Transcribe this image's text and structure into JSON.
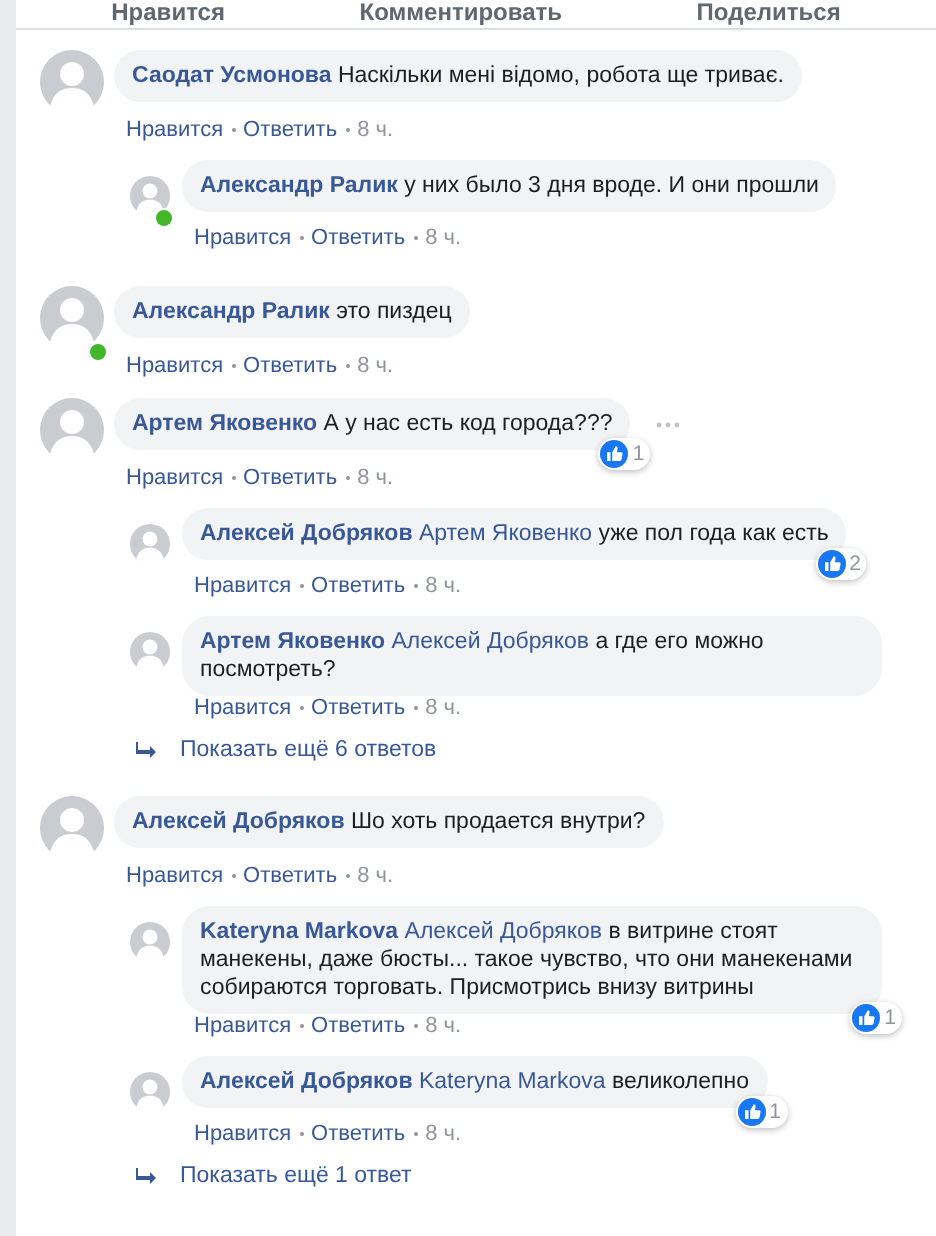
{
  "actions": [
    {
      "label": "Нравится"
    },
    {
      "label": "Комментировать"
    },
    {
      "label": "Поделиться"
    }
  ],
  "comments": [
    {
      "author": "Саодат Усмонова",
      "text": "Наскільки мені відомо, робота ще триває.",
      "online": false,
      "like": "Нравится",
      "reply": "Ответить",
      "time": "8 ч.",
      "replies": [
        {
          "author": "Александр Ралик",
          "text": "у них было 3 дня вроде. И они прошли",
          "online": true,
          "like": "Нравится",
          "reply": "Ответить",
          "time": "8 ч."
        }
      ]
    },
    {
      "author": "Александр Ралик",
      "text": "это пиздец",
      "online": true,
      "like": "Нравится",
      "reply": "Ответить",
      "time": "8 ч."
    },
    {
      "author": "Артем Яковенко",
      "text": "А у нас есть код города???",
      "online": false,
      "reactions": "1",
      "menu": true,
      "like": "Нравится",
      "reply": "Ответить",
      "time": "8 ч.",
      "replies": [
        {
          "author": "Алексей Добряков",
          "mention": "Артем Яковенко",
          "text": "уже пол года как есть",
          "online": false,
          "reactions": "2",
          "like": "Нравится",
          "reply": "Ответить",
          "time": "8 ч."
        },
        {
          "author": "Артем Яковенко",
          "mention": "Алексей Добряков",
          "text": "а где его можно посмотреть?",
          "online": false,
          "like": "Нравится",
          "reply": "Ответить",
          "time": "8 ч."
        }
      ],
      "more_replies": "Показать ещё 6 ответов"
    },
    {
      "author": "Алексей Добряков",
      "text": "Шо хоть продается внутри?",
      "online": false,
      "like": "Нравится",
      "reply": "Ответить",
      "time": "8 ч.",
      "replies": [
        {
          "author": "Kateryna Markova",
          "mention": "Алексей Добряков",
          "text": "в витрине стоят манекены, даже бюсты... такое чувство, что они манекенами собираются торговать. Присмотрись внизу витрины",
          "online": false,
          "reactions": "1",
          "like": "Нравится",
          "reply": "Ответить",
          "time": "8 ч."
        },
        {
          "author": "Алексей Добряков",
          "mention": "Kateryna Markova",
          "text": "великолепно",
          "online": false,
          "reactions": "1",
          "like": "Нравится",
          "reply": "Ответить",
          "time": "8 ч."
        }
      ],
      "more_replies": "Показать ещё 1 ответ"
    }
  ]
}
